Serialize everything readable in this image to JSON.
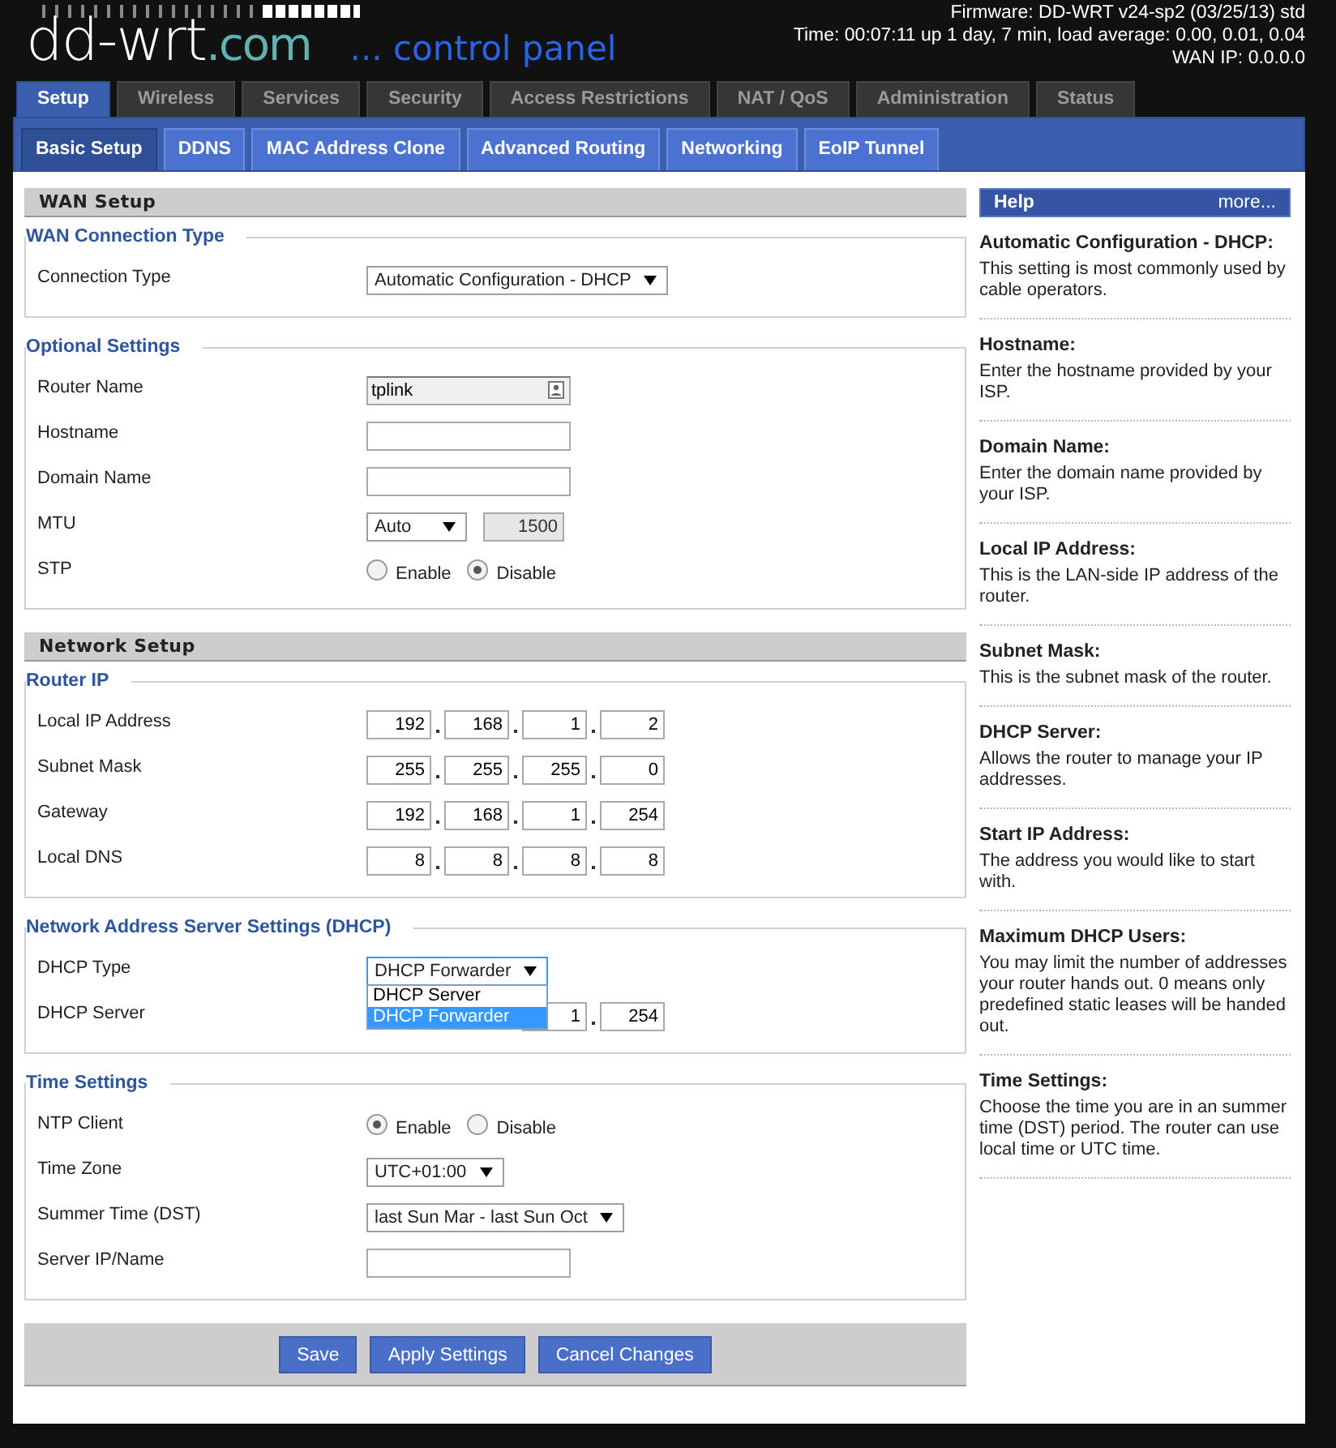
{
  "header": {
    "logo": {
      "name": "dd-wrt",
      "domain": ".com",
      "tagline": "... control panel"
    },
    "info": [
      "Firmware: DD-WRT v24-sp2 (03/25/13) std",
      "Time: 00:07:11 up 1 day, 7 min, load average: 0.00, 0.01, 0.04",
      "WAN IP: 0.0.0.0"
    ]
  },
  "tabs": [
    {
      "label": "Setup",
      "selected": true
    },
    {
      "label": "Wireless",
      "selected": false
    },
    {
      "label": "Services",
      "selected": false
    },
    {
      "label": "Security",
      "selected": false
    },
    {
      "label": "Access Restrictions",
      "selected": false
    },
    {
      "label": "NAT / QoS",
      "selected": false
    },
    {
      "label": "Administration",
      "selected": false
    },
    {
      "label": "Status",
      "selected": false
    }
  ],
  "subtabs": [
    {
      "label": "Basic Setup",
      "selected": true
    },
    {
      "label": "DDNS",
      "selected": false
    },
    {
      "label": "MAC Address Clone",
      "selected": false
    },
    {
      "label": "Advanced Routing",
      "selected": false
    },
    {
      "label": "Networking",
      "selected": false
    },
    {
      "label": "EoIP Tunnel",
      "selected": false
    }
  ],
  "sections": [
    {
      "title": "WAN Setup",
      "groups": [
        {
          "legend": "WAN Connection Type",
          "rows": [
            {
              "label": "Connection Type",
              "kind": "select",
              "value": "Automatic Configuration - DHCP"
            }
          ]
        },
        {
          "legend": "Optional Settings",
          "rows": [
            {
              "label": "Router Name",
              "kind": "text",
              "value": "tplink",
              "autofill_icon": true
            },
            {
              "label": "Hostname",
              "kind": "text"
            },
            {
              "label": "Domain Name",
              "kind": "text"
            },
            {
              "label": "MTU",
              "kind": "select_text",
              "value": "Auto",
              "field": {
                "value": "1500",
                "disabled": true
              }
            },
            {
              "label": "STP",
              "kind": "radio",
              "options": [
                {
                  "label": "Enable",
                  "selected": false
                },
                {
                  "label": "Disable",
                  "selected": true
                }
              ]
            }
          ]
        }
      ]
    },
    {
      "title": "Network Setup",
      "groups": [
        {
          "legend": "Router IP",
          "rows": [
            {
              "label": "Local IP Address",
              "kind": "ip",
              "octets": [
                "192",
                "168",
                "1",
                "2"
              ]
            },
            {
              "label": "Subnet Mask",
              "kind": "ip",
              "octets": [
                "255",
                "255",
                "255",
                "0"
              ]
            },
            {
              "label": "Gateway",
              "kind": "ip",
              "octets": [
                "192",
                "168",
                "1",
                "254"
              ]
            },
            {
              "label": "Local DNS",
              "kind": "ip",
              "octets": [
                "8",
                "8",
                "8",
                "8"
              ]
            }
          ]
        },
        {
          "legend": "Network Address Server Settings (DHCP)",
          "rows": [
            {
              "label": "DHCP Type",
              "kind": "select",
              "value": "DHCP Forwarder",
              "open": true,
              "options": [
                {
                  "label": "DHCP Server",
                  "selected": false
                },
                {
                  "label": "DHCP Forwarder",
                  "selected": true
                }
              ]
            },
            {
              "label": "DHCP Server",
              "kind": "ip",
              "octets": [
                "1",
                "254"
              ]
            }
          ]
        },
        {
          "legend": "Time Settings",
          "rows": [
            {
              "label": "NTP Client",
              "kind": "radio",
              "options": [
                {
                  "label": "Enable",
                  "selected": true
                },
                {
                  "label": "Disable",
                  "selected": false
                }
              ]
            },
            {
              "label": "Time Zone",
              "kind": "select",
              "value": "UTC+01:00"
            },
            {
              "label": "Summer Time (DST)",
              "kind": "select",
              "value": "last Sun Mar - last Sun Oct"
            },
            {
              "label": "Server IP/Name",
              "kind": "text"
            }
          ]
        }
      ]
    }
  ],
  "buttons": [
    "Save",
    "Apply Settings",
    "Cancel Changes"
  ],
  "help": {
    "title": "Help",
    "more": "more...",
    "items": [
      {
        "title": "Automatic Configuration - DHCP:",
        "text": "This setting is most commonly used by cable operators."
      },
      {
        "title": "Hostname:",
        "text": "Enter the hostname provided by your ISP."
      },
      {
        "title": "Domain Name:",
        "text": "Enter the domain name provided by your ISP."
      },
      {
        "title": "Local IP Address:",
        "text": "This is the LAN-side IP address of the router."
      },
      {
        "title": "Subnet Mask:",
        "text": "This is the subnet mask of the router."
      },
      {
        "title": "DHCP Server:",
        "text": "Allows the router to manage your IP addresses."
      },
      {
        "title": "Start IP Address:",
        "text": "The address you would like to start with."
      },
      {
        "title": "Maximum DHCP Users:",
        "text": "You may limit the number of addresses your router hands out. 0 means only predefined static leases will be handed out."
      },
      {
        "title": "Time Settings:",
        "text": "Choose the time you are in an summer time (DST) period. The router can use local time or UTC time."
      }
    ]
  }
}
